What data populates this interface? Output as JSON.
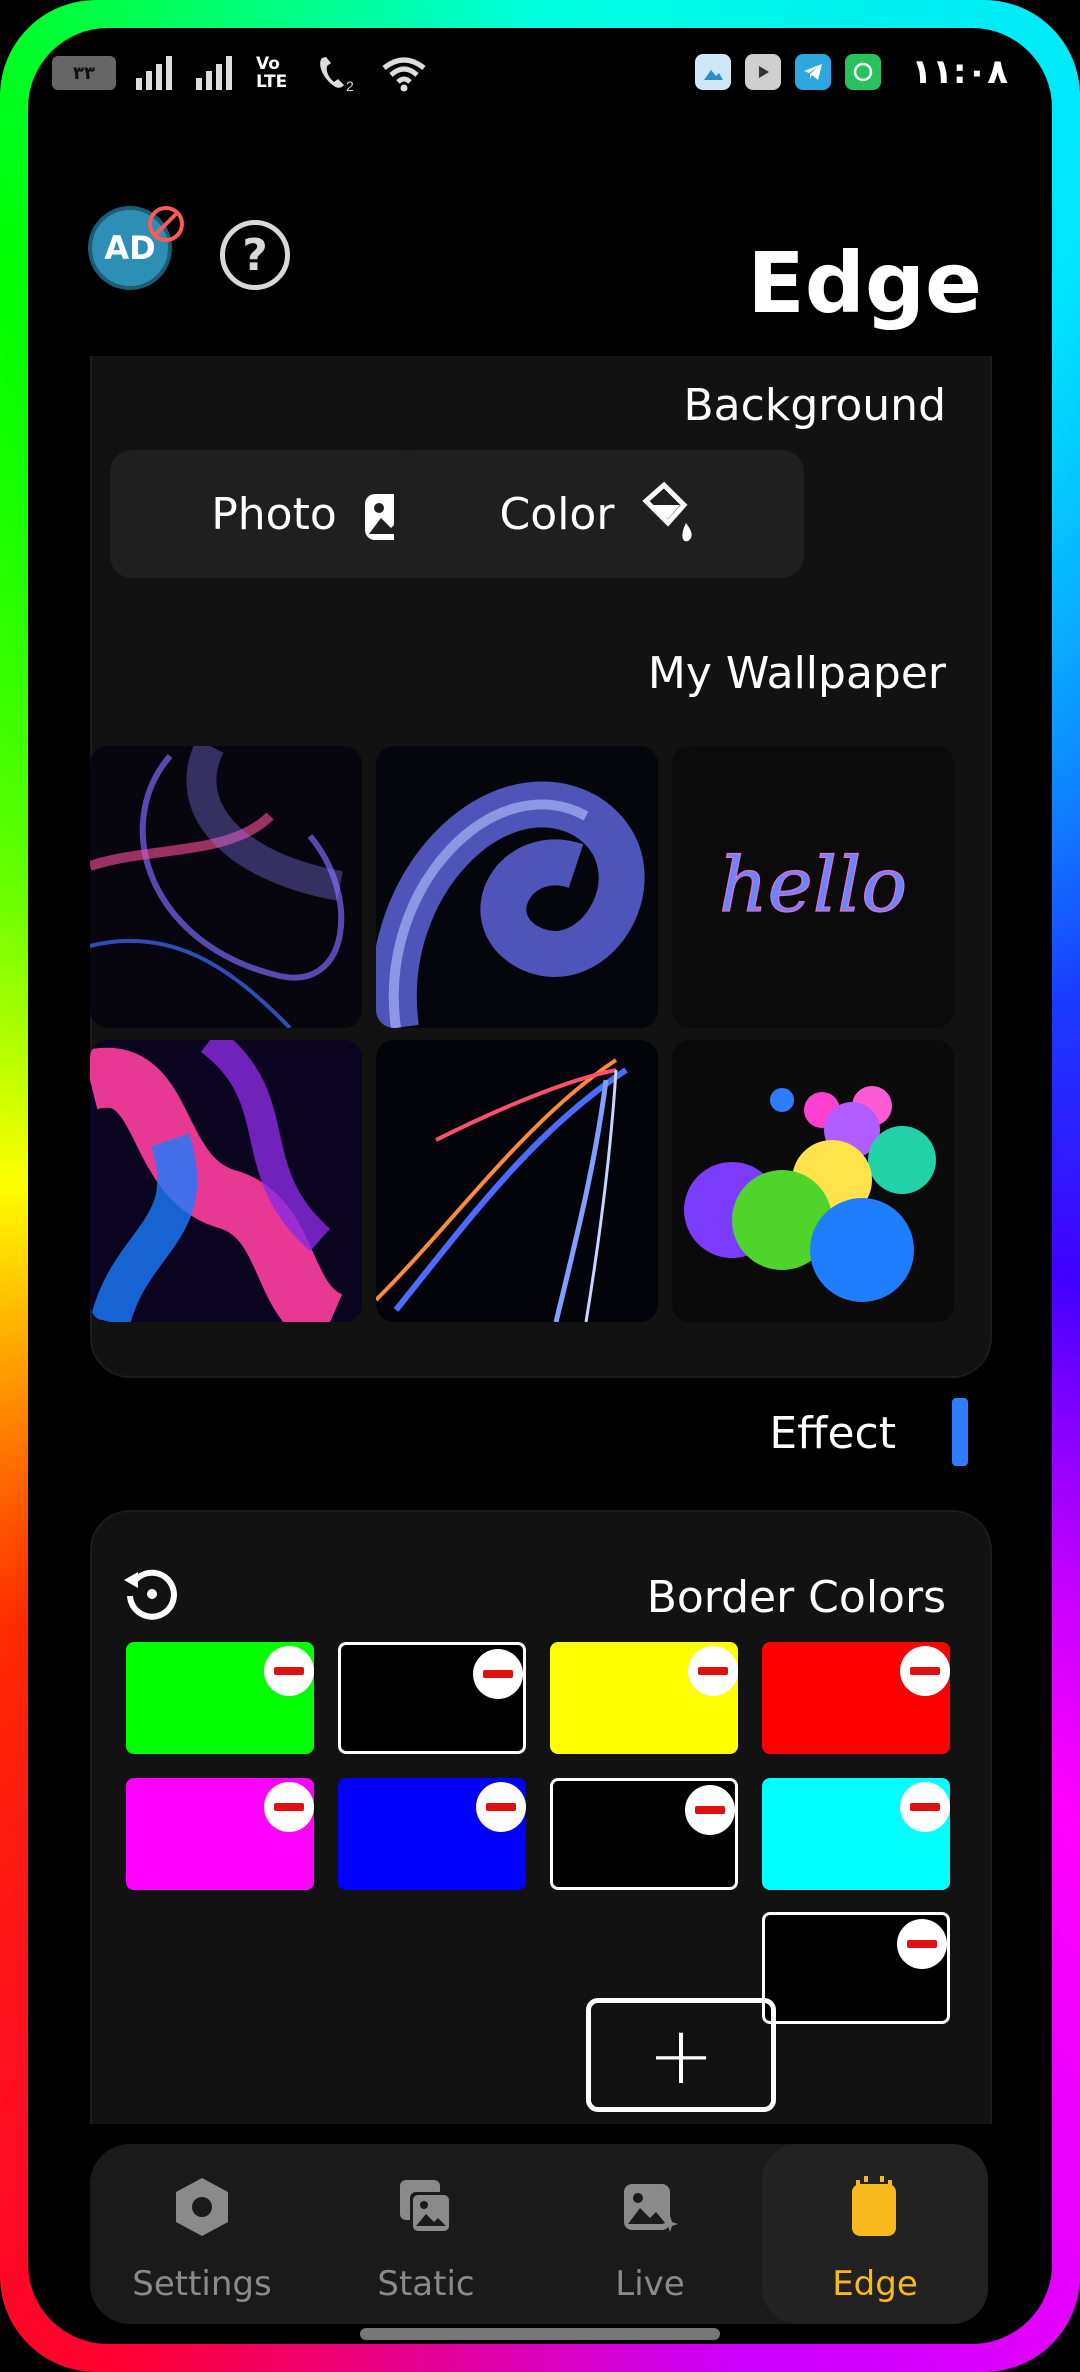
{
  "status_bar": {
    "battery": "۳۳",
    "volte_label": "Vo LTE",
    "sim_label": "2",
    "time": "۱۱:۰۸",
    "app_icons": [
      "gallery-icon",
      "youtube-icon",
      "telegram-icon",
      "whatsapp-icon"
    ]
  },
  "header": {
    "avatar_text": "AD",
    "help_label": "?",
    "title": "Edge"
  },
  "background": {
    "label": "Background",
    "photo_button": "Photo",
    "color_button": "Color"
  },
  "wallpapers": {
    "label": "My Wallpaper",
    "items": [
      {
        "name": "purple-swirl"
      },
      {
        "name": "blue-loop"
      },
      {
        "name": "hello",
        "text": "hello"
      },
      {
        "name": "pink-wave"
      },
      {
        "name": "light-streak"
      },
      {
        "name": "glowing-balls"
      }
    ]
  },
  "effect": {
    "label": "Effect"
  },
  "border_colors": {
    "label": "Border Colors",
    "add_label": "+",
    "colors": [
      "#00ff00",
      "#000000",
      "#ffff00",
      "#ff0000",
      "#ff00ff",
      "#0000ff",
      "#000000",
      "#00ffff",
      "#000000"
    ]
  },
  "nav": {
    "items": [
      {
        "label": "Settings",
        "icon": "hexagon-icon"
      },
      {
        "label": "Static",
        "icon": "images-icon"
      },
      {
        "label": "Live",
        "icon": "live-image-icon"
      },
      {
        "label": "Edge",
        "icon": "phone-edge-icon"
      }
    ],
    "active": "Edge",
    "active_color": "#f7b91c"
  }
}
